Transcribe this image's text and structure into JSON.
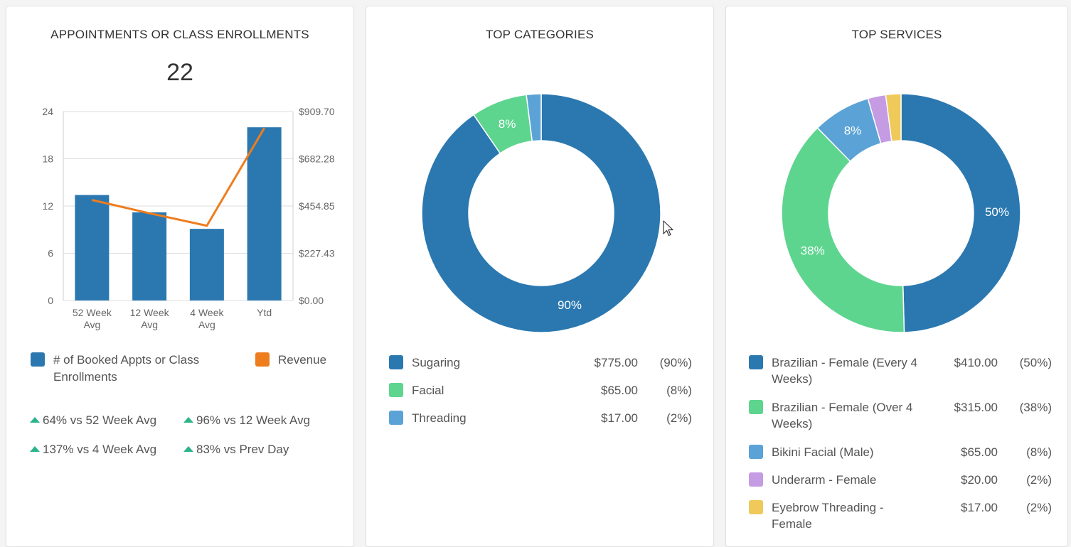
{
  "appointments": {
    "title": "APPOINTMENTS OR CLASS ENROLLMENTS",
    "total": "22",
    "chart_data": {
      "type": "bar",
      "categories": [
        "52 Week Avg",
        "12 Week Avg",
        "4 Week Avg",
        "Ytd"
      ],
      "category_lines": [
        [
          "52 Week",
          "Avg"
        ],
        [
          "12 Week",
          "Avg"
        ],
        [
          "4 Week",
          "Avg"
        ],
        [
          "Ytd"
        ]
      ],
      "series": [
        {
          "name": "# of Booked Appts or Class Enrollments",
          "type": "bar",
          "axis": "left",
          "values": [
            13.4,
            11.2,
            9.1,
            22
          ],
          "color": "#2b78b0"
        },
        {
          "name": "Revenue",
          "type": "line",
          "axis": "right",
          "values": [
            484,
            420,
            360,
            830
          ],
          "color": "#ee7d1e"
        }
      ],
      "ylim_left": [
        0,
        24
      ],
      "yticks_left": [
        "0",
        "6",
        "12",
        "18",
        "24"
      ],
      "ylim_right": [
        0,
        909.7
      ],
      "yticks_right": [
        "$0.00",
        "$227.43",
        "$454.85",
        "$682.28",
        "$909.70"
      ],
      "grid": true
    },
    "legend": {
      "bars_label_line1": "# of Booked Appts or Class",
      "bars_label_line2": "Enrollments",
      "line_label": "Revenue"
    },
    "comparisons": [
      "64% vs 52 Week Avg",
      "96% vs 12 Week Avg",
      "137% vs 4 Week Avg",
      "83% vs Prev Day"
    ],
    "up_color": "#2bb389"
  },
  "categories": {
    "title": "TOP CATEGORIES",
    "chart_data": {
      "type": "pie",
      "donut": true,
      "slices": [
        {
          "label": "Sugaring",
          "value": 775.0,
          "percent": 90,
          "shown_label": "90%",
          "color": "#2b78b0"
        },
        {
          "label": "Facial",
          "value": 65.0,
          "percent": 8,
          "shown_label": "8%",
          "color": "#5ed58f"
        },
        {
          "label": "Threading",
          "value": 17.0,
          "percent": 2,
          "shown_label": "",
          "color": "#5ba3d6"
        }
      ]
    },
    "legend": [
      {
        "label": "Sugaring",
        "amount": "$775.00",
        "pct": "(90%)"
      },
      {
        "label": "Facial",
        "amount": "$65.00",
        "pct": "(8%)"
      },
      {
        "label": "Threading",
        "amount": "$17.00",
        "pct": "(2%)"
      }
    ]
  },
  "services": {
    "title": "TOP SERVICES",
    "chart_data": {
      "type": "pie",
      "donut": true,
      "slices": [
        {
          "label": "Brazilian - Female (Every 4 Weeks)",
          "value": 410.0,
          "percent": 50,
          "shown_label": "50%",
          "color": "#2b78b0"
        },
        {
          "label": "Brazilian - Female (Over 4 Weeks)",
          "value": 315.0,
          "percent": 38,
          "shown_label": "38%",
          "color": "#5ed58f"
        },
        {
          "label": "Bikini Facial (Male)",
          "value": 65.0,
          "percent": 8,
          "shown_label": "8%",
          "color": "#5ba3d6"
        },
        {
          "label": "Underarm - Female",
          "value": 20.0,
          "percent": 2,
          "shown_label": "",
          "color": "#c59be3"
        },
        {
          "label": "Eyebrow Threading - Female",
          "value": 17.0,
          "percent": 2,
          "shown_label": "",
          "color": "#efc95a"
        }
      ]
    },
    "legend": [
      {
        "label1": "Brazilian - Female (Every 4",
        "label2": "Weeks)",
        "amount": "$410.00",
        "pct": "(50%)"
      },
      {
        "label1": "Brazilian - Female (Over 4",
        "label2": "Weeks)",
        "amount": "$315.00",
        "pct": "(38%)"
      },
      {
        "label1": "Bikini Facial (Male)",
        "label2": "",
        "amount": "$65.00",
        "pct": "(8%)"
      },
      {
        "label1": "Underarm - Female",
        "label2": "",
        "amount": "$20.00",
        "pct": "(2%)"
      },
      {
        "label1": "Eyebrow Threading -",
        "label2": "Female",
        "amount": "$17.00",
        "pct": "(2%)"
      }
    ]
  }
}
